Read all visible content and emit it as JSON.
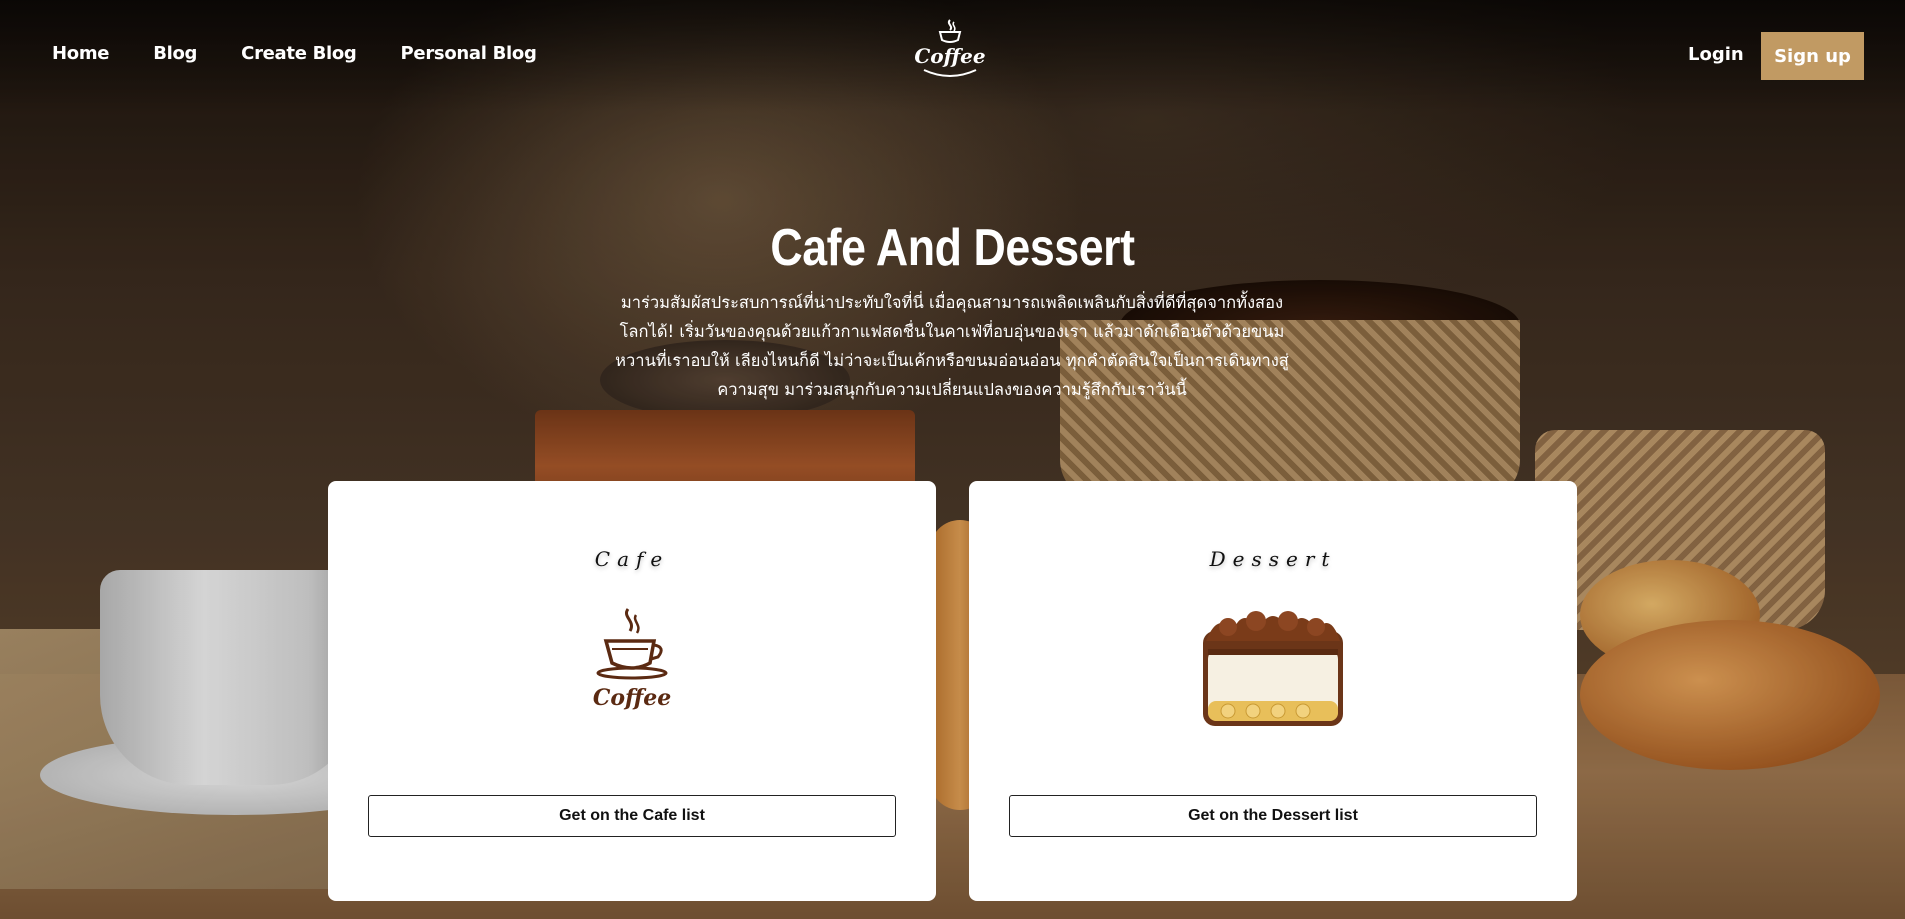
{
  "nav": {
    "links": [
      {
        "label": "Home"
      },
      {
        "label": "Blog"
      },
      {
        "label": "Create Blog"
      },
      {
        "label": "Personal Blog"
      }
    ],
    "logo_text": "Coffee",
    "login_label": "Login",
    "signup_label": "Sign up"
  },
  "hero": {
    "title": "Cafe And Dessert",
    "description": "มาร่วมสัมผัสประสบการณ์ที่น่าประทับใจที่นี่ เมื่อคุณสามารถเพลิดเพลินกับสิ่งที่ดีที่สุดจากทั้งสองโลกได้! เริ่มวันของคุณด้วยแก้วกาแฟสดชื่นในคาเฟ่ที่อบอุ่นของเรา แล้วมาดักเดือนตัวด้วยขนมหวานที่เราอบให้ เลียงไหนก็ดี ไม่ว่าจะเป็นเค้กหรือขนมอ่อนอ่อน ทุกคำตัดสินใจเป็นการเดินทางสู่ความสุข มาร่วมสนุกกับความเปลี่ยนแปลงของความรู้สึกกับเราวันนี้"
  },
  "cards": [
    {
      "title": "Cafe",
      "logo_text": "Coffee",
      "button_label": "Get on the Cafe list"
    },
    {
      "title": "Dessert",
      "button_label": "Get on the Dessert list"
    }
  ],
  "colors": {
    "signup_bg": "#c19a63",
    "coffee_brown": "#5b2a12"
  }
}
